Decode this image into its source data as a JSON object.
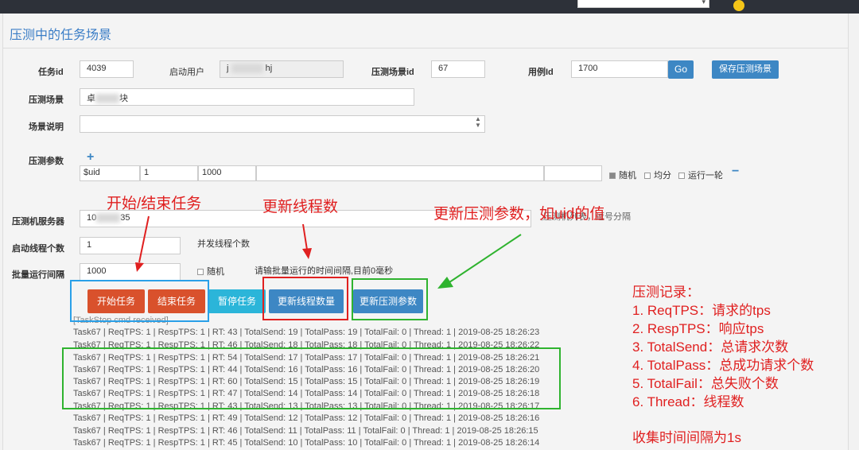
{
  "topbar": {
    "select_value": "",
    "username": ""
  },
  "page": {
    "title": "压测中的任务场景"
  },
  "form": {
    "task_id_label": "任务id",
    "task_id_value": "4039",
    "start_user_label": "启动用户",
    "start_user_value_a": "j",
    "start_user_value_b": "hj",
    "scene_id_label": "压测场景id",
    "scene_id_value": "67",
    "case_id_label": "用例Id",
    "case_id_value": "1700",
    "go_button": "Go",
    "save_button": "保存压测场景",
    "scene_label": "压测场景",
    "scene_value_a": "卓",
    "scene_value_b": "块",
    "desc_label": "场景说明",
    "desc_value": "",
    "params_label": "压测参数",
    "add_symbol": "+",
    "param_name": "$uid",
    "param_start": "1",
    "param_end": "1000",
    "param_extra": "",
    "param_extra2": "",
    "random_label": "随机",
    "even_label": "均分",
    "run_once_label": "运行一轮",
    "remove_symbol": "−",
    "server_label": "压测机服务器",
    "server_value_a": "10",
    "server_value_b": "35",
    "server_hint": ",压测机列表，逗号分隔",
    "threads_label": "启动线程个数",
    "threads_value": "1",
    "threads_hint": "并发线程个数",
    "interval_label": "批量运行间隔",
    "interval_value": "1000",
    "interval_random": "随机",
    "interval_hint": "请输批量运行的时间间隔,目前0毫秒"
  },
  "buttons": {
    "start": "开始任务",
    "stop": "结束任务",
    "pause": "暂停任务",
    "update_threads": "更新线程数量",
    "update_params": "更新压测参数"
  },
  "log": {
    "header": "[TaskStop cmd received]",
    "lines": [
      "Task67 | ReqTPS: 1 | RespTPS: 1 | RT: 43 | TotalSend: 19 | TotalPass: 19 | TotalFail: 0 | Thread: 1 | 2019-08-25 18:26:23",
      "Task67 | ReqTPS: 1 | RespTPS: 1 | RT: 46 | TotalSend: 18 | TotalPass: 18 | TotalFail: 0 | Thread: 1 | 2019-08-25 18:26:22",
      "Task67 | ReqTPS: 1 | RespTPS: 1 | RT: 54 | TotalSend: 17 | TotalPass: 17 | TotalFail: 0 | Thread: 1 | 2019-08-25 18:26:21",
      "Task67 | ReqTPS: 1 | RespTPS: 1 | RT: 44 | TotalSend: 16 | TotalPass: 16 | TotalFail: 0 | Thread: 1 | 2019-08-25 18:26:20",
      "Task67 | ReqTPS: 1 | RespTPS: 1 | RT: 60 | TotalSend: 15 | TotalPass: 15 | TotalFail: 0 | Thread: 1 | 2019-08-25 18:26:19",
      "Task67 | ReqTPS: 1 | RespTPS: 1 | RT: 47 | TotalSend: 14 | TotalPass: 14 | TotalFail: 0 | Thread: 1 | 2019-08-25 18:26:18",
      "Task67 | ReqTPS: 1 | RespTPS: 1 | RT: 43 | TotalSend: 13 | TotalPass: 13 | TotalFail: 0 | Thread: 1 | 2019-08-25 18:26:17",
      "Task67 | ReqTPS: 1 | RespTPS: 1 | RT: 49 | TotalSend: 12 | TotalPass: 12 | TotalFail: 0 | Thread: 1 | 2019-08-25 18:26:16",
      "Task67 | ReqTPS: 1 | RespTPS: 1 | RT: 46 | TotalSend: 11 | TotalPass: 11 | TotalFail: 0 | Thread: 1 | 2019-08-25 18:26:15",
      "Task67 | ReqTPS: 1 | RespTPS: 1 | RT: 45 | TotalSend: 10 | TotalPass: 10 | TotalFail: 0 | Thread: 1 | 2019-08-25 18:26:14"
    ]
  },
  "annotations": {
    "start_stop": "开始/结束任务",
    "threads": "更新线程数",
    "params": "更新压测参数，如uid的值",
    "legend_title": "压测记录：",
    "legend_items": [
      "1. ReqTPS：请求的tps",
      "2. RespTPS：响应tps",
      "3. TotalSend：总请求次数",
      "4. TotalPass：总成功请求个数",
      "5. TotalFail：总失败个数",
      "6. Thread：线程数"
    ],
    "interval_note": "收集时间间隔为1s"
  },
  "colors": {
    "accent_blue": "#3d87c4",
    "danger_red": "#d9512c",
    "cyan": "#2bb5d9",
    "annotation_red": "#e02020",
    "annotation_green": "#2fb32f",
    "annotation_blue": "#2aa0e8"
  }
}
